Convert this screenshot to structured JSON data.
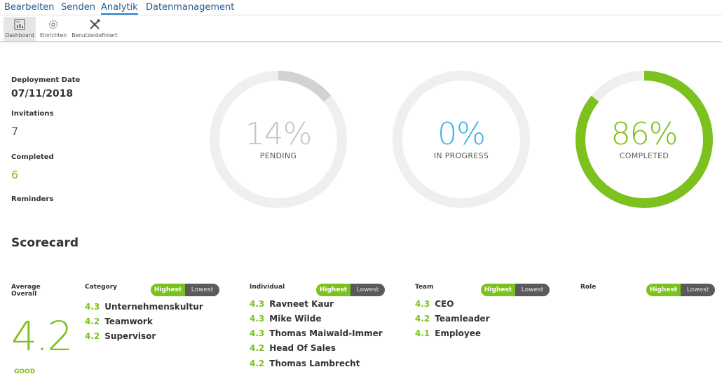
{
  "menu": [
    "Bearbeiten",
    "Senden",
    "Analytik",
    "Datenmanagement"
  ],
  "menu_active": "Analytik",
  "toolbar": {
    "dashboard_label": "Dashboard",
    "setup_label": "Einrichten",
    "custom_label": "Benutzerdefiniert"
  },
  "stats": {
    "deployment_date_label": "Deployment Date",
    "deployment_date": "07/11/2018",
    "invitations_label": "Invitations",
    "invitations": "7",
    "completed_label": "Completed",
    "completed": "6",
    "reminders_label": "Reminders"
  },
  "gauges": [
    {
      "percent_text": "14%",
      "caption": "PENDING",
      "fraction": 0.14,
      "color": "#d2d2d2",
      "text_color": "#c4c4c4"
    },
    {
      "percent_text": "0%",
      "caption": "IN PROGRESS",
      "fraction": 0.0,
      "color": "#3fb3e8",
      "text_color": "#3fb3e8"
    },
    {
      "percent_text": "86%",
      "caption": "COMPLETED",
      "fraction": 0.86,
      "color": "#7dc11e",
      "text_color": "#7dc11e"
    }
  ],
  "scorecard": {
    "title": "Scorecard",
    "average_label": "Average Overall",
    "average_value": "4.2",
    "average_rating": "GOOD",
    "toggle": {
      "highest": "Highest",
      "lowest": "Lowest"
    },
    "category": {
      "label": "Category",
      "items": [
        {
          "score": "4.3",
          "name": "Unternehmenskultur"
        },
        {
          "score": "4.2",
          "name": "Teamwork"
        },
        {
          "score": "4.2",
          "name": "Supervisor"
        }
      ]
    },
    "individual": {
      "label": "Individual",
      "items": [
        {
          "score": "4.3",
          "name": "Ravneet Kaur"
        },
        {
          "score": "4.3",
          "name": "Mike Wilde"
        },
        {
          "score": "4.3",
          "name": "Thomas Maiwald-Immer"
        },
        {
          "score": "4.2",
          "name": "Head Of Sales"
        },
        {
          "score": "4.2",
          "name": "Thomas Lambrecht"
        }
      ]
    },
    "team": {
      "label": "Team",
      "items": [
        {
          "score": "4.3",
          "name": "CEO"
        },
        {
          "score": "4.2",
          "name": "Teamleader"
        },
        {
          "score": "4.1",
          "name": "Employee"
        }
      ]
    },
    "role": {
      "label": "Role",
      "items": []
    }
  },
  "colors": {
    "accent_green": "#7dc11e",
    "accent_blue": "#3fb3e8",
    "link_blue": "#1f5a92",
    "track_gray": "#efefef"
  }
}
